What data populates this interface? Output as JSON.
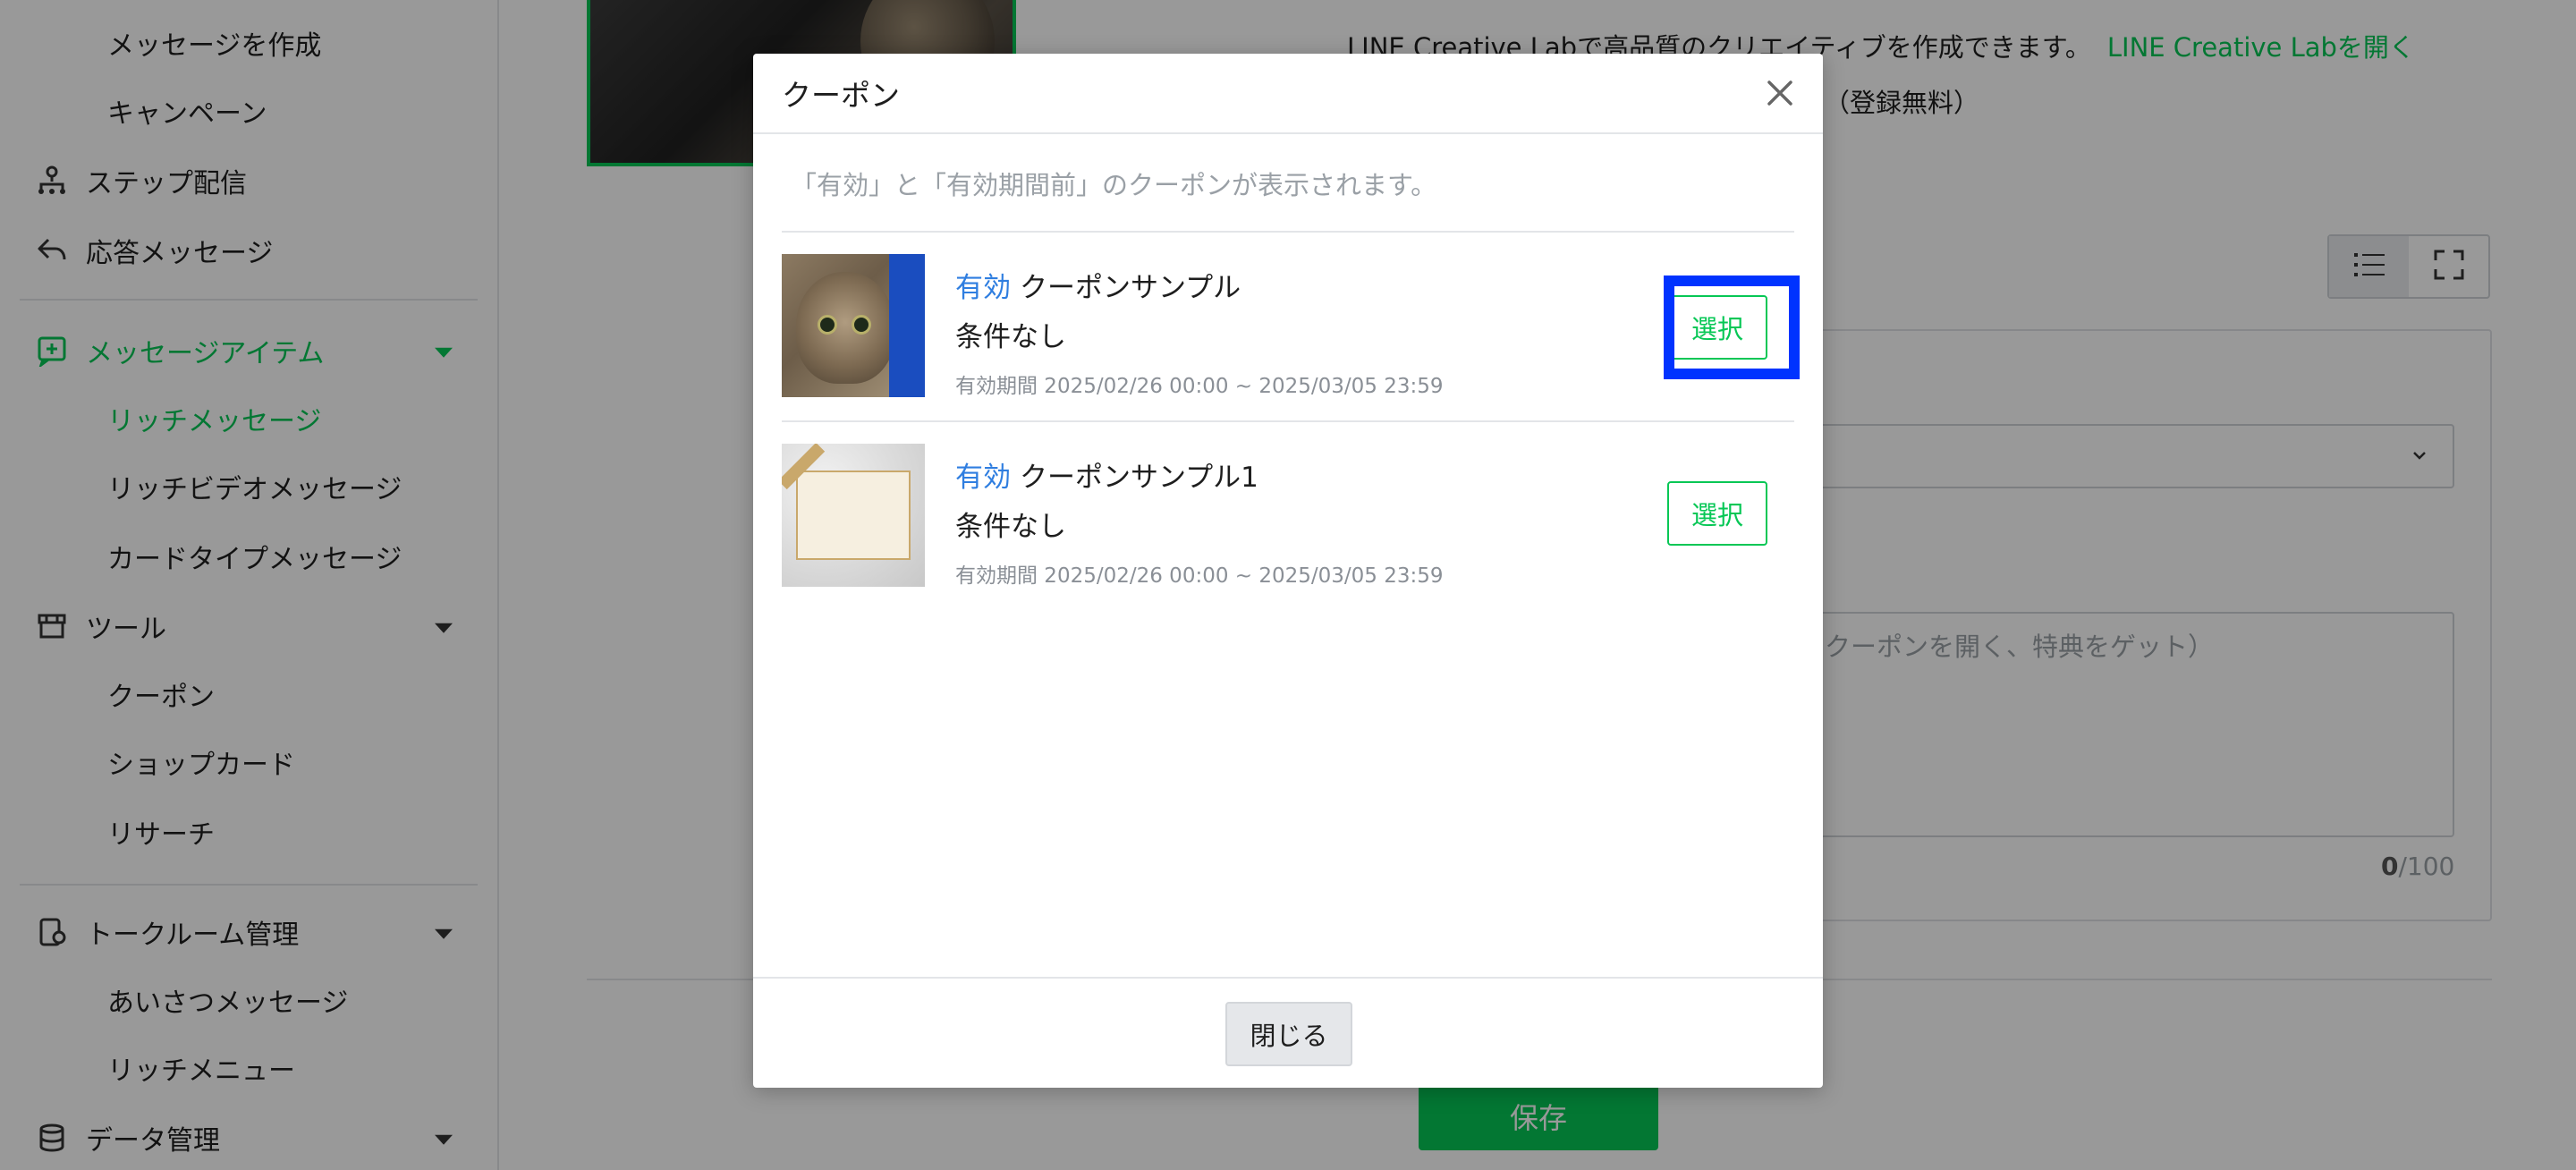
{
  "sidebar": {
    "items": [
      {
        "label": "メッセージを作成"
      },
      {
        "label": "キャンペーン"
      },
      {
        "label": "ステップ配信"
      },
      {
        "label": "応答メッセージ"
      },
      {
        "label": "メッセージアイテム"
      },
      {
        "label": "リッチメッセージ"
      },
      {
        "label": "リッチビデオメッセージ"
      },
      {
        "label": "カードタイプメッセージ"
      },
      {
        "label": "ツール"
      },
      {
        "label": "クーポン"
      },
      {
        "label": "ショップカード"
      },
      {
        "label": "リサーチ"
      },
      {
        "label": "トークルーム管理"
      },
      {
        "label": "あいさつメッセージ"
      },
      {
        "label": "リッチメニュー"
      },
      {
        "label": "データ管理"
      }
    ]
  },
  "main": {
    "lab_text": "LINE Creative Labで高品質のクリエイティブを作成できます。",
    "lab_link": "LINE Creative Labを開く",
    "free_text": "す（登録無料）",
    "textarea_placeholder": "クーポンを開く、特典をゲット）",
    "counter_current": "0",
    "counter_max": "/100",
    "save_label": "保存"
  },
  "modal": {
    "title": "クーポン",
    "note": "「有効」と「有効期間前」のクーポンが表示されます。",
    "coupons": [
      {
        "status": "有効",
        "name": "クーポンサンプル",
        "condition": "条件なし",
        "period": "有効期間 2025/02/26 00:00 ~ 2025/03/05 23:59",
        "select_label": "選択"
      },
      {
        "status": "有効",
        "name": "クーポンサンプル1",
        "condition": "条件なし",
        "period": "有効期間 2025/02/26 00:00 ~ 2025/03/05 23:59",
        "select_label": "選択"
      }
    ],
    "close_label": "閉じる"
  },
  "colors": {
    "brand_green": "#06c755",
    "status_blue": "#2f7ee0",
    "highlight_blue": "#0033ff"
  },
  "icons": [
    "step-icon",
    "reply-icon",
    "message-item-icon",
    "tool-icon",
    "talkroom-icon",
    "data-icon",
    "list-view-icon",
    "fullscreen-icon",
    "chevron-down-icon",
    "close-icon"
  ]
}
